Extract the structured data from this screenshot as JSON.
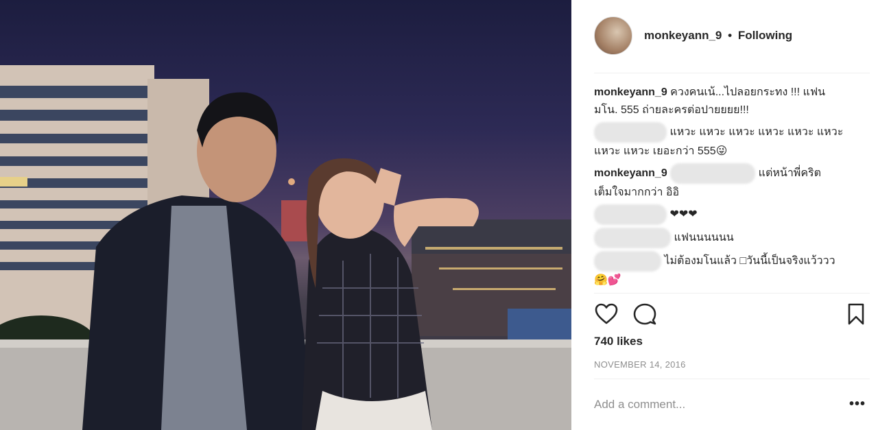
{
  "post": {
    "username": "monkeyann_9",
    "separator": "•",
    "follow_status": "Following"
  },
  "comments": [
    {
      "user": "monkeyann_9",
      "text": "ควงคนเน้...ไปลอยกระทง !!! แฟนมโน. 555 ถ่ายละครต่อปายยยย!!!"
    },
    {
      "user": "",
      "text": "แหวะ แหวะ แหวะ แหวะ แหวะ แหวะ แหวะ แหวะ เยอะกว่า 555😜"
    },
    {
      "user": "monkeyann_9",
      "mention": "",
      "text": "แต่หน้าพี่คริต เต็มใจมากกว่า อิอิ"
    },
    {
      "user": "",
      "text": "❤❤❤"
    },
    {
      "user": "",
      "text": "แฟนนนนนน"
    },
    {
      "user": "",
      "text": "ไม่ต้องมโนแล้ว □วันนี้เป็นจริงแว้ววว🤗💕"
    }
  ],
  "likes_text": "740 likes",
  "date_text": "NOVEMBER 14, 2016",
  "add_comment_placeholder": "Add a comment...",
  "more_label": "•••",
  "icons": {
    "like": "heart-icon",
    "comment": "comment-bubble-icon",
    "save": "bookmark-icon"
  },
  "colors": {
    "text": "#262626",
    "muted": "#8e8e8e",
    "divider": "#efefef"
  }
}
